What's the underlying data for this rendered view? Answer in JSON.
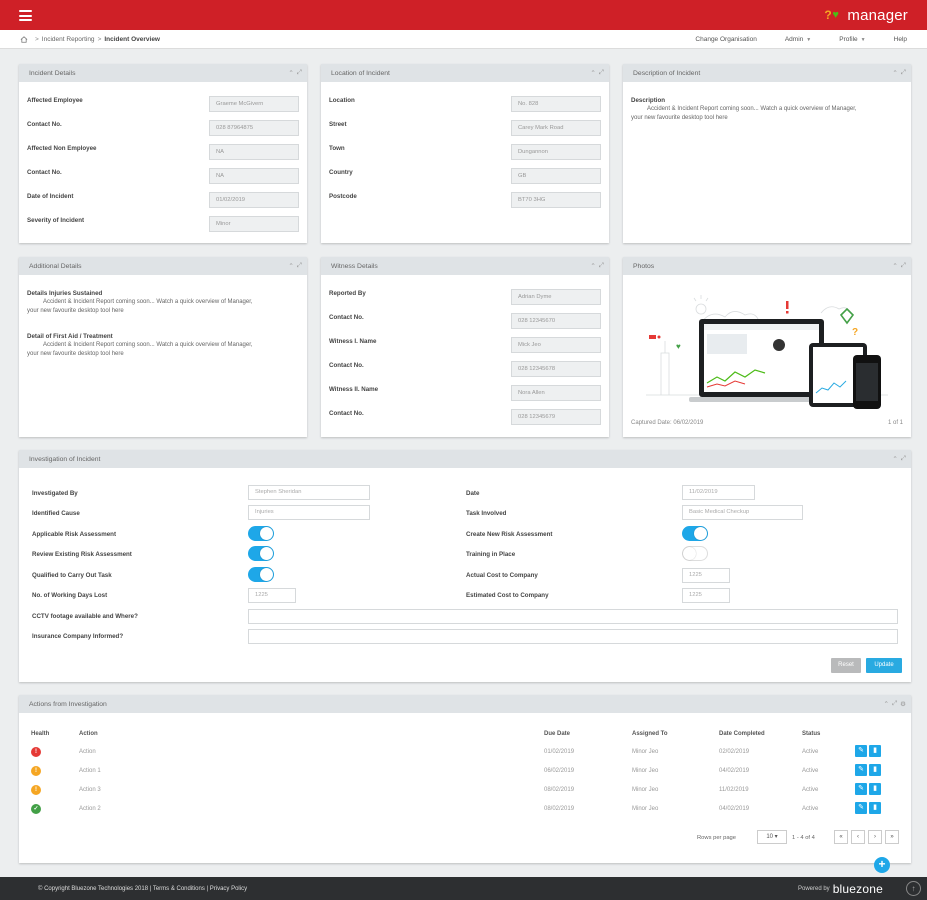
{
  "app": {
    "brand": "manager",
    "menu_icon": "hamburger-icon"
  },
  "breadcrumb": {
    "items": [
      "Incident Reporting",
      "Incident Overview"
    ]
  },
  "topnav": {
    "change_org": "Change Organisation",
    "admin": "Admin",
    "profile": "Profile",
    "help": "Help"
  },
  "incident_details": {
    "title": "Incident Details",
    "fields": [
      {
        "label": "Affected Employee",
        "value": "Graeme McGivern"
      },
      {
        "label": "Contact No.",
        "value": "028 87964875"
      },
      {
        "label": "Affected Non Employee",
        "value": "NA"
      },
      {
        "label": "Contact No.",
        "value": "NA"
      },
      {
        "label": "Date of Incident",
        "value": "01/02/2019"
      },
      {
        "label": "Severity of Incident",
        "value": "Minor"
      }
    ]
  },
  "location": {
    "title": "Location of Incident",
    "fields": [
      {
        "label": "Location",
        "value": "No. 828"
      },
      {
        "label": "Street",
        "value": "Carey Mark Road"
      },
      {
        "label": "Town",
        "value": "Dungannon"
      },
      {
        "label": "Country",
        "value": "GB"
      },
      {
        "label": "Postcode",
        "value": "BT70 3HG"
      }
    ]
  },
  "description": {
    "title": "Description of Incident",
    "label": "Description",
    "text_line1": "Accident & Incident Report coming soon... Watch a quick overview of Manager,",
    "text_line2": "your new favourite desktop tool here"
  },
  "additional": {
    "title": "Additional Details",
    "injuries_label": "Details Injuries Sustained",
    "injuries_line1": "Accident & Incident Report coming soon... Watch a quick overview of Manager,",
    "injuries_line2": "your new favourite desktop tool here",
    "firstaid_label": "Detail of First Aid / Treatment",
    "firstaid_line1": "Accident & Incident Report coming soon... Watch a quick overview of Manager,",
    "firstaid_line2": "your new favourite desktop tool here"
  },
  "witness": {
    "title": "Witness Details",
    "fields": [
      {
        "label": "Reported By",
        "value": "Adrian Dyme"
      },
      {
        "label": "Contact No.",
        "value": "028 12345670"
      },
      {
        "label": "Witness I. Name",
        "value": "Mick Jeo"
      },
      {
        "label": "Contact No.",
        "value": "028 12345678"
      },
      {
        "label": "Witness II. Name",
        "value": "Nora Allen"
      },
      {
        "label": "Contact No.",
        "value": "028 12345679"
      }
    ]
  },
  "photos": {
    "title": "Photos",
    "captured": "Captured Date: 06/02/2019",
    "pager": "1 of 1"
  },
  "investigation": {
    "title": "Investigation of Incident",
    "investigated_by_label": "Investigated By",
    "investigated_by_value": "Stephen Sheridan",
    "identified_cause_label": "Identified Cause",
    "identified_cause_value": "Injuries",
    "applicable_risk_label": "Applicable Risk Assessment",
    "applicable_risk_on": true,
    "review_risk_label": "Review Existing Risk Assessment",
    "review_risk_on": true,
    "qualified_label": "Qualified to Carry Out Task",
    "qualified_on": true,
    "days_lost_label": "No. of Working Days Lost",
    "days_lost_value": "1225",
    "cctv_label": "CCTV footage available and Where?",
    "insurance_label": "Insurance Company Informed?",
    "date_label": "Date",
    "date_value": "11/02/2019",
    "task_label": "Task Involved",
    "task_value": "Basic Medical Checkup",
    "create_risk_label": "Create New Risk Assessment",
    "create_risk_on": true,
    "training_label": "Training in Place",
    "training_on": false,
    "actual_cost_label": "Actual Cost to Company",
    "actual_cost_value": "1225",
    "est_cost_label": "Estimated Cost to Company",
    "est_cost_value": "1225",
    "reset": "Reset",
    "update": "Update"
  },
  "actions": {
    "title": "Actions from Investigation",
    "headers": {
      "health": "Health",
      "action": "Action",
      "due": "Due Date",
      "assigned": "Assigned To",
      "completed": "Date Completed",
      "status": "Status"
    },
    "rows": [
      {
        "health_color": "#e53935",
        "action": "Action",
        "due": "01/02/2019",
        "assigned": "Minor Jeo",
        "completed": "02/02/2019",
        "status": "Active"
      },
      {
        "health_color": "#f5a623",
        "action": "Action 1",
        "due": "06/02/2019",
        "assigned": "Minor Jeo",
        "completed": "04/02/2019",
        "status": "Active"
      },
      {
        "health_color": "#f5a623",
        "action": "Action 3",
        "due": "08/02/2019",
        "assigned": "Minor Jeo",
        "completed": "11/02/2019",
        "status": "Active"
      },
      {
        "health_color": "#43a047",
        "action": "Action 2",
        "due": "08/02/2019",
        "assigned": "Minor Jeo",
        "completed": "04/02/2019",
        "status": "Active"
      }
    ],
    "rows_per_page_label": "Rows per page",
    "rows_per_page": "10",
    "range": "1 - 4 of 4"
  },
  "footer": {
    "copyright": "© Copyright Bluezone Technologies 2018 | Terms & Conditions | Privacy Policy",
    "powered": "Powered by",
    "brand": "bluezone"
  }
}
